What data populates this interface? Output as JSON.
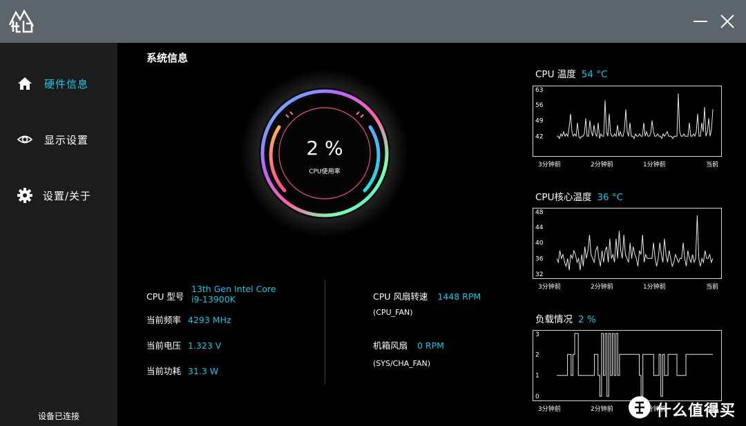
{
  "window": {
    "logo_icon": "mountain-logo-icon",
    "minimize_icon": "minimize-icon",
    "close_icon": "close-icon"
  },
  "sidebar": {
    "items": [
      {
        "label": "硬件信息",
        "icon": "home-icon",
        "active": true
      },
      {
        "label": "显示设置",
        "icon": "eye-icon",
        "active": false
      },
      {
        "label": "设置/关于",
        "icon": "gear-icon",
        "active": false
      }
    ],
    "status": "设备已连接"
  },
  "main": {
    "title": "系统信息",
    "gauge": {
      "value_text": "2 %",
      "value": 2,
      "label": "CPU使用率"
    },
    "info_left": [
      {
        "key": "CPU 型号",
        "value_line1": "13th Gen Intel Core",
        "value_line2": "i9-13900K"
      },
      {
        "key": "当前频率",
        "value": "4293 MHz"
      },
      {
        "key": "当前电压",
        "value": "1.323 V"
      },
      {
        "key": "当前功耗",
        "value": "31.3 W"
      }
    ],
    "info_right": [
      {
        "key": "CPU 风扇转速",
        "value": "1448 RPM",
        "sub": "(CPU_FAN)"
      },
      {
        "key": "机箱风扇",
        "value": "0 RPM",
        "sub": "(SYS/CHA_FAN)"
      }
    ]
  },
  "charts": [
    {
      "title": "CPU 温度",
      "value": "54 °C",
      "y_ticks": [
        "63",
        "56",
        "49",
        "42"
      ],
      "ylim": [
        35,
        63
      ],
      "x_ticks": [
        "3分钟前",
        "2分钟前",
        "1分钟前",
        "当前"
      ],
      "series": [
        42,
        42,
        41,
        43,
        42,
        44,
        42,
        43,
        42,
        46,
        52,
        44,
        42,
        43,
        42,
        48,
        42,
        41,
        42,
        42,
        43,
        50,
        42,
        42,
        49,
        44,
        42,
        47,
        43,
        42,
        48,
        41,
        43,
        42,
        42,
        58,
        44,
        42,
        52,
        43,
        42,
        42,
        43,
        42,
        47,
        42,
        44,
        42,
        42,
        45,
        54,
        44,
        42,
        48,
        42,
        42,
        41,
        43,
        42,
        42,
        43,
        42,
        42,
        48,
        42,
        44,
        42,
        42,
        43,
        49,
        44,
        42,
        42,
        43,
        42,
        42,
        41,
        43,
        42,
        43,
        44,
        42,
        42,
        42,
        41,
        42,
        42,
        42,
        61,
        44,
        42,
        42,
        43,
        42,
        42,
        42,
        48,
        42,
        42,
        43,
        42,
        44,
        52,
        42,
        42,
        48,
        44,
        55,
        42,
        44,
        50,
        42,
        45,
        54
      ]
    },
    {
      "title": "CPU核心温度",
      "value": "36 °C",
      "y_ticks": [
        "48",
        "44",
        "40",
        "36",
        "32"
      ],
      "ylim": [
        32,
        48
      ],
      "x_ticks": [
        "3分钟前",
        "2分钟前",
        "1分钟前",
        "当前"
      ],
      "series": [
        36,
        35,
        38,
        36,
        37,
        35,
        34,
        36,
        33,
        37,
        36,
        38,
        37,
        35,
        36,
        33,
        37,
        34,
        39,
        36,
        38,
        42,
        37,
        36,
        35,
        38,
        39,
        36,
        34,
        38,
        35,
        38,
        39,
        35,
        41,
        36,
        37,
        35,
        41,
        36,
        43,
        38,
        36,
        42,
        37,
        36,
        35,
        40,
        36,
        39,
        37,
        36,
        34,
        38,
        37,
        42,
        35,
        37,
        36,
        36,
        36,
        36,
        40,
        36,
        34,
        36,
        40,
        37,
        35,
        41,
        37,
        35,
        38,
        36,
        34,
        35,
        37,
        36,
        35,
        36,
        36,
        40,
        36,
        34,
        38,
        36,
        35,
        37,
        35,
        36,
        47,
        36,
        34,
        36,
        35,
        38,
        36,
        36,
        37,
        35,
        36
      ]
    },
    {
      "title": "负载情况",
      "value": "2 %",
      "y_ticks": [
        "3",
        "2",
        "1",
        "0"
      ],
      "ylim": [
        0,
        3
      ],
      "x_ticks": [
        "3分钟前",
        "2分钟前",
        "1分钟前",
        "当前"
      ],
      "series": [
        1,
        1,
        1,
        1,
        1,
        1,
        2,
        2,
        1,
        2,
        3,
        3,
        1,
        1,
        1,
        1,
        1,
        1,
        1,
        1,
        1,
        2,
        2,
        1,
        0,
        3,
        1,
        3,
        0,
        3,
        1,
        3,
        1,
        3,
        1,
        2,
        2,
        2,
        2,
        2,
        2,
        2,
        2,
        2,
        2,
        2,
        1,
        0,
        2,
        2,
        2,
        2,
        2,
        2,
        1,
        1,
        1,
        2,
        0,
        2,
        1,
        1,
        2,
        2,
        2,
        2,
        2,
        1,
        1,
        1,
        1,
        1,
        2,
        2,
        2,
        2,
        2,
        2,
        2,
        2,
        2,
        2,
        2,
        2,
        2,
        2,
        2,
        2
      ]
    }
  ],
  "watermark": {
    "text": "什么值得买",
    "icon": "watermark-logo-icon"
  },
  "colors": {
    "accent": "#18c6e6",
    "titlebar": "#5d656c",
    "sidebar": "#1c1c1c",
    "background": "#000000"
  }
}
